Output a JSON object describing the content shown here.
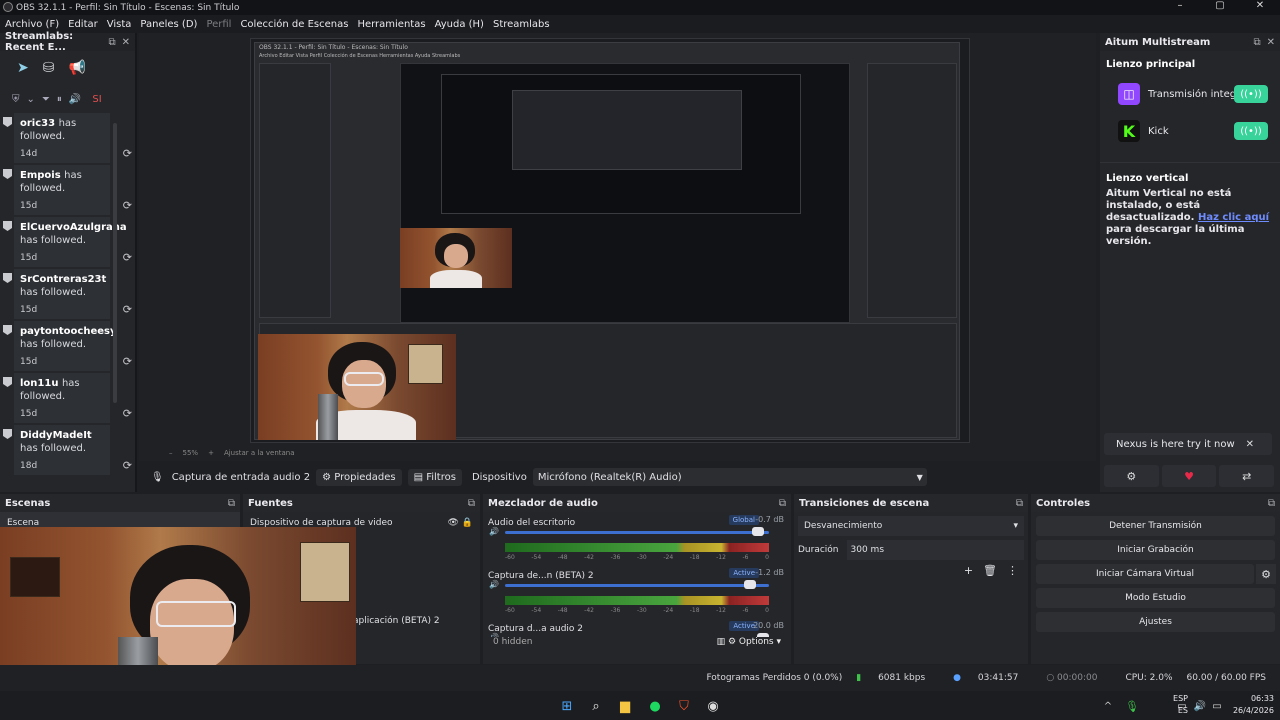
{
  "window": {
    "title": "OBS 32.1.1 - Perfil: Sin Título - Escenas: Sin Título",
    "controls": [
      "–",
      "▢",
      "✕"
    ]
  },
  "menu": [
    "Archivo (F)",
    "Editar",
    "Vista",
    "Paneles (D)",
    "Perfil",
    "Colección de Escenas",
    "Herramientas",
    "Ayuda (H)",
    "Streamlabs"
  ],
  "left_dock": {
    "title": "Streamlabs: Recent E...",
    "tool_badge": "SI",
    "alerts": [
      {
        "name": "oric33",
        "text": "has followed.",
        "age": "14d"
      },
      {
        "name": "Empois",
        "text": "has followed.",
        "age": "15d"
      },
      {
        "name": "ElCuervoAzulgrana",
        "text": "has followed.",
        "age": "15d"
      },
      {
        "name": "SrContreras23t",
        "text": "has followed.",
        "age": "15d"
      },
      {
        "name": "paytontoocheesy",
        "text": "has followed.",
        "age": "15d"
      },
      {
        "name": "lon11u",
        "text": "has followed.",
        "age": "15d"
      },
      {
        "name": "DiddyMadeIt",
        "text": "has followed.",
        "age": "18d"
      }
    ]
  },
  "preview": {
    "nested_title": "OBS 32.1.1 - Perfil: Sin Título - Escenas: Sin Título",
    "nested_menu": "Archivo  Editar  Vista  Perfil  Colección de Escenas  Herramientas  Ayuda  Streamlabs",
    "zoom": "55%",
    "fit": "Ajustar a la ventana"
  },
  "right_dock": {
    "title": "Aitum Multistream",
    "main_canvas": "Lienzo principal",
    "platforms": [
      {
        "name": "Transmisión integrada",
        "icon": "twitch-icon",
        "color": "#9146ff"
      },
      {
        "name": "Kick",
        "icon": "kick-icon",
        "color": "#53fc18"
      }
    ],
    "vertical_title": "Lienzo vertical",
    "vertical_msg": "Aitum Vertical no está instalado, o está desactualizado.",
    "vertical_link": "Haz clic aquí",
    "vertical_msg2": "para descargar la última versión.",
    "nexus": "Nexus is here try it now"
  },
  "source_bar": {
    "source": "Captura de entrada audio 2",
    "properties": "Propiedades",
    "filters": "Filtros",
    "device_label": "Dispositivo",
    "device": "Micrófono (Realtek(R) Audio)"
  },
  "scenes": {
    "title": "Escenas",
    "items": [
      "Escena"
    ]
  },
  "sources": {
    "title": "Fuentes",
    "items": [
      "Dispositivo de captura de video",
      "aplicación (BETA) 2"
    ]
  },
  "mixer": {
    "title": "Mezclador de audio",
    "tracks": [
      {
        "name": "Audio del escritorio",
        "tag": "Global",
        "db": "-0.7 dB",
        "level": 0.98
      },
      {
        "name": "Captura de...n (BETA) 2",
        "tag": "Active",
        "db": "-1.2 dB",
        "level": 0.95
      },
      {
        "name": "Captura d...a audio 2",
        "tag": "Active",
        "db": "20.0 dB",
        "level": 1.0
      }
    ],
    "ticks": [
      "-60",
      "-54",
      "-48",
      "-42",
      "-36",
      "-30",
      "-24",
      "-18",
      "-12",
      "-6",
      "0"
    ],
    "hidden": "0 hidden",
    "options": "Options"
  },
  "transitions": {
    "title": "Transiciones de escena",
    "type": "Desvanecimiento",
    "duration_label": "Duración",
    "duration": "300 ms"
  },
  "controls": {
    "title": "Controles",
    "buttons": [
      "Detener Transmisión",
      "Iniciar Grabación",
      "Iniciar Cámara Virtual",
      "Modo Estudio",
      "Ajustes"
    ]
  },
  "status": {
    "dropped": "Fotogramas Perdidos 0 (0.0%)",
    "bitrate": "6081 kbps",
    "stream_time": "03:41:57",
    "rec_time": "00:00:00",
    "cpu": "CPU: 2.0%",
    "fps": "60.00 / 60.00 FPS"
  },
  "taskbar": {
    "lang1": "ESP",
    "lang2": "ES",
    "time": "06:33",
    "date": "26/4/2026"
  }
}
